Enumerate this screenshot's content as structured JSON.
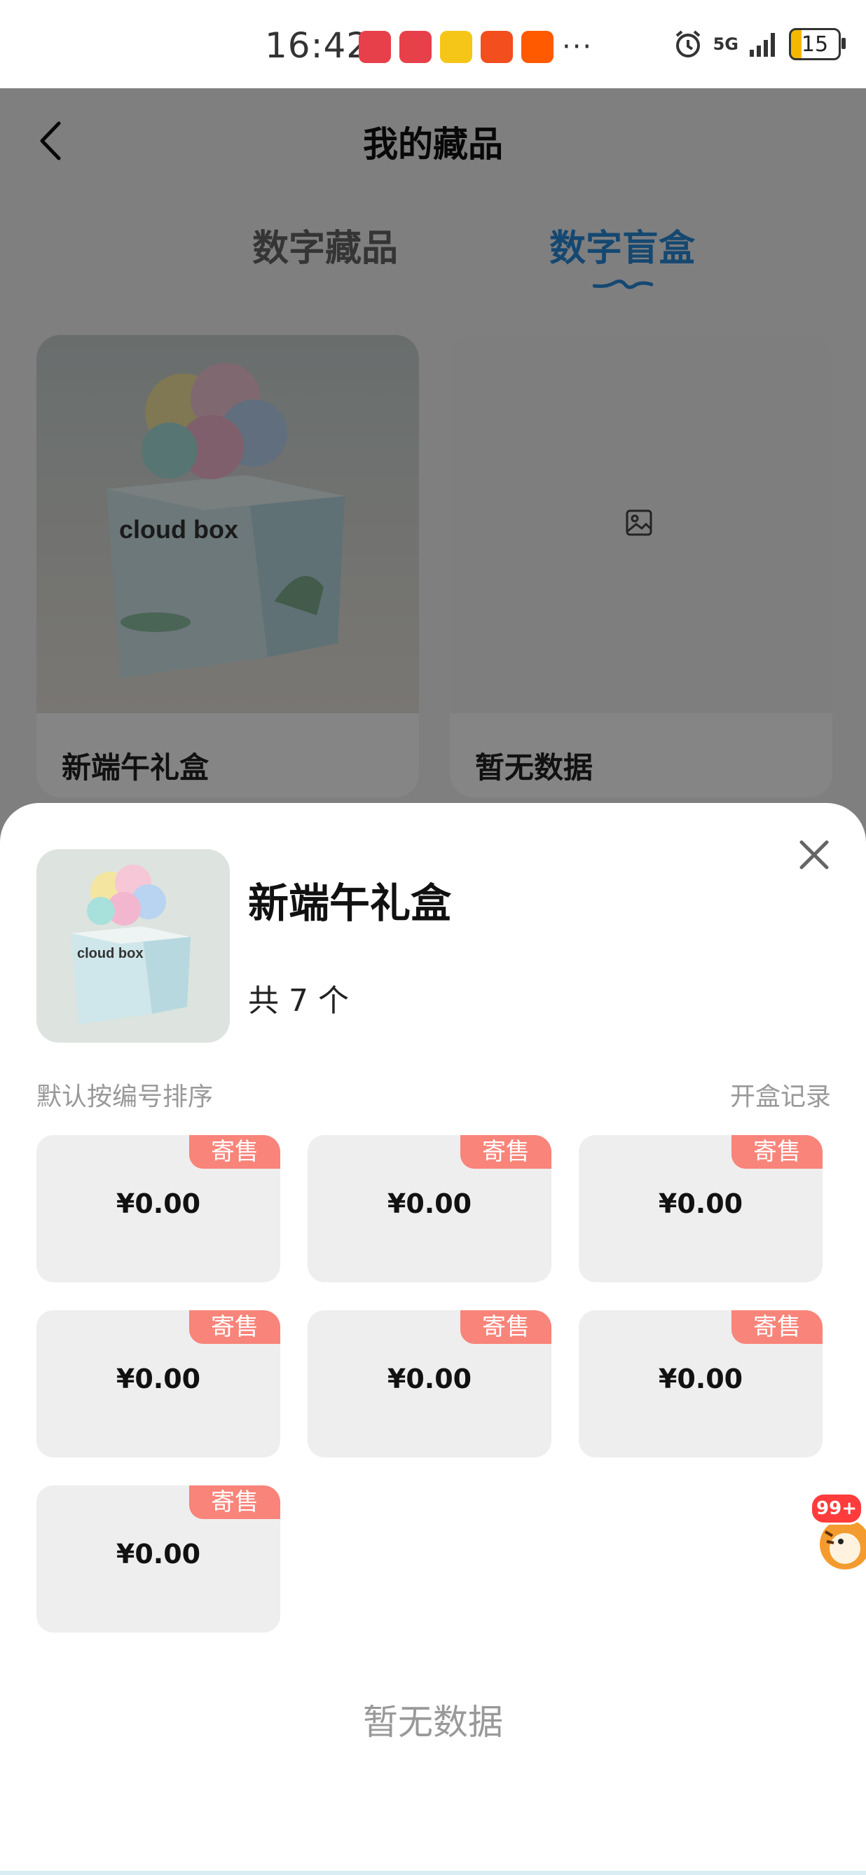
{
  "status_bar": {
    "time": "16:42",
    "apps": [
      {
        "icon": "huawei-store-icon",
        "color": "#e8404a"
      },
      {
        "icon": "huawei-store-icon",
        "color": "#e8404a"
      },
      {
        "icon": "weibo-icon",
        "color": "#f5c518"
      },
      {
        "icon": "app-alert-icon",
        "color": "#f24e1e"
      },
      {
        "icon": "taobao-icon",
        "color": "#ff5a00"
      }
    ],
    "more": "···",
    "network": "5G",
    "battery": "15"
  },
  "page": {
    "title": "我的藏品",
    "tabs": [
      {
        "label": "数字藏品",
        "active": false
      },
      {
        "label": "数字盲盒",
        "active": true
      }
    ],
    "cards": [
      {
        "label": "新端午礼盒",
        "image": "cloud box"
      },
      {
        "label": "暂无数据"
      }
    ]
  },
  "sheet": {
    "title": "新端午礼盒",
    "count": "共 7 个",
    "thumb_text": "cloud box",
    "sort_label": "默认按编号排序",
    "record_link": "开盒记录",
    "items": [
      {
        "tag": "寄售",
        "price": "¥0.00"
      },
      {
        "tag": "寄售",
        "price": "¥0.00"
      },
      {
        "tag": "寄售",
        "price": "¥0.00"
      },
      {
        "tag": "寄售",
        "price": "¥0.00"
      },
      {
        "tag": "寄售",
        "price": "¥0.00"
      },
      {
        "tag": "寄售",
        "price": "¥0.00"
      },
      {
        "tag": "寄售",
        "price": "¥0.00"
      }
    ],
    "empty_text": "暂无数据"
  },
  "floating": {
    "badge": "99+"
  }
}
